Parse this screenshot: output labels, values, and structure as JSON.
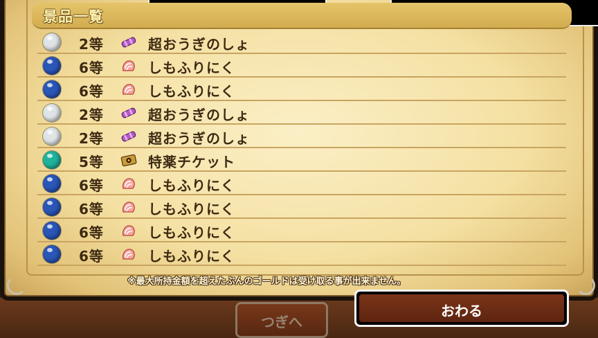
{
  "panel": {
    "title": "景品一覧",
    "footnote": "※最大所持金額を超えたぶんのゴールドは受け取る事が出来ません。"
  },
  "prizes": [
    {
      "orb": "silver",
      "rank": "2等",
      "icon": "scroll-icon",
      "name": "超おうぎのしょ"
    },
    {
      "orb": "blue",
      "rank": "6等",
      "icon": "meat-icon",
      "name": "しもふりにく"
    },
    {
      "orb": "blue",
      "rank": "6等",
      "icon": "meat-icon",
      "name": "しもふりにく"
    },
    {
      "orb": "silver",
      "rank": "2等",
      "icon": "scroll-icon",
      "name": "超おうぎのしょ"
    },
    {
      "orb": "silver",
      "rank": "2等",
      "icon": "scroll-icon",
      "name": "超おうぎのしょ"
    },
    {
      "orb": "teal",
      "rank": "5等",
      "icon": "ticket-icon",
      "name": "特薬チケット"
    },
    {
      "orb": "blue",
      "rank": "6等",
      "icon": "meat-icon",
      "name": "しもふりにく"
    },
    {
      "orb": "blue",
      "rank": "6等",
      "icon": "meat-icon",
      "name": "しもふりにく"
    },
    {
      "orb": "blue",
      "rank": "6等",
      "icon": "meat-icon",
      "name": "しもふりにく"
    },
    {
      "orb": "blue",
      "rank": "6等",
      "icon": "meat-icon",
      "name": "しもふりにく"
    }
  ],
  "buttons": {
    "next_label": "つぎへ",
    "end_label": "おわる"
  },
  "colors": {
    "orb_silver": "#dfe4e6",
    "orb_blue": "#2a56b8",
    "orb_teal": "#1fb39c",
    "parchment": "#f4e0a2"
  }
}
